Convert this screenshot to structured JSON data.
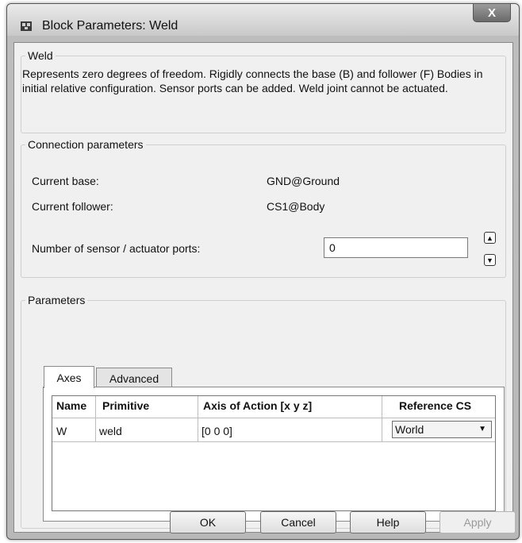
{
  "window": {
    "title": "Block Parameters: Weld",
    "close_glyph": "X",
    "icon": "simulink-block-icon"
  },
  "weld_group": {
    "legend": "Weld",
    "description": "Represents zero degrees of freedom. Rigidly connects the base (B) and follower (F) Bodies in initial relative configuration. Sensor ports can be added. Weld joint cannot be actuated."
  },
  "connection": {
    "legend": "Connection parameters",
    "base_label": "Current base:",
    "base_value": "GND@Ground",
    "follower_label": "Current follower:",
    "follower_value": "CS1@Body",
    "ports_label": "Number of sensor / actuator ports:",
    "ports_value": "0"
  },
  "parameters": {
    "legend": "Parameters",
    "tabs": [
      {
        "label": "Axes",
        "active": true
      },
      {
        "label": "Advanced",
        "active": false
      }
    ],
    "table": {
      "columns": [
        "Name",
        "Primitive",
        "Axis of Action [x y z]",
        "Reference CS"
      ],
      "rows": [
        {
          "name": "W",
          "primitive": "weld",
          "axis": "[0 0 0]",
          "reference_cs": "World"
        }
      ]
    }
  },
  "buttons": {
    "ok": "OK",
    "cancel": "Cancel",
    "help": "Help",
    "apply": "Apply"
  }
}
